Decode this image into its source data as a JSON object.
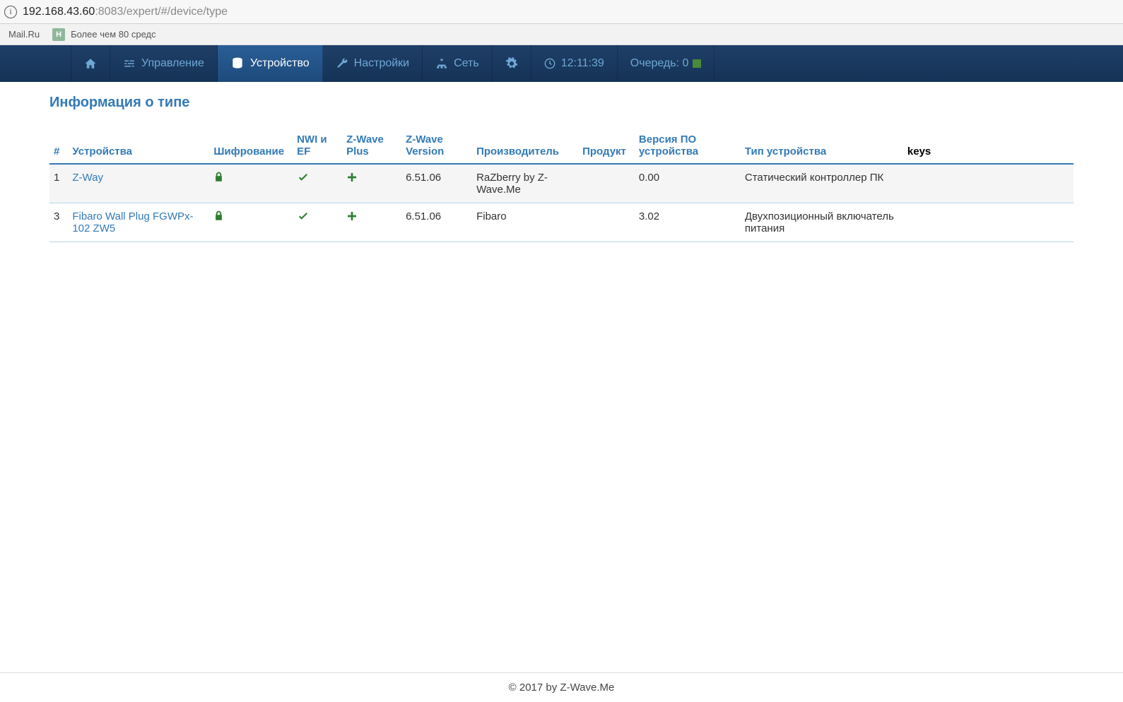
{
  "browser": {
    "url_host": "192.168.43.60",
    "url_port_path": ":8083/expert/#/device/type",
    "bookmarks": {
      "mailru": "Mail.Ru",
      "link2": "Более чем 80 средс"
    }
  },
  "nav": {
    "control": "Управление",
    "device": "Устройство",
    "settings": "Настройки",
    "network": "Сеть",
    "time": "12:11:39",
    "queue": "Очередь: 0"
  },
  "page": {
    "title": "Информация о типе",
    "footer": "© 2017 by Z-Wave.Me"
  },
  "table": {
    "headers": {
      "num": "#",
      "devices": "Устройства",
      "encryption": "Шифрование",
      "nwi_ef": "NWI и EF",
      "zwave_plus": "Z-Wave Plus",
      "zwave_version": "Z-Wave Version",
      "manufacturer": "Производитель",
      "product": "Продукт",
      "firmware": "Версия ПО устройства",
      "device_type": "Тип устройства",
      "keys": "keys"
    },
    "rows": [
      {
        "num": "1",
        "device": "Z-Way",
        "zwave_version": "6.51.06",
        "manufacturer": "RaZberry by Z-Wave.Me",
        "product": "",
        "firmware": "0.00",
        "device_type": "Статический контроллер ПК",
        "keys": ""
      },
      {
        "num": "3",
        "device": "Fibaro Wall Plug FGWPx-102 ZW5",
        "zwave_version": "6.51.06",
        "manufacturer": "Fibaro",
        "product": "",
        "firmware": "3.02",
        "device_type": "Двухпозиционный включатель питания",
        "keys": ""
      }
    ]
  }
}
